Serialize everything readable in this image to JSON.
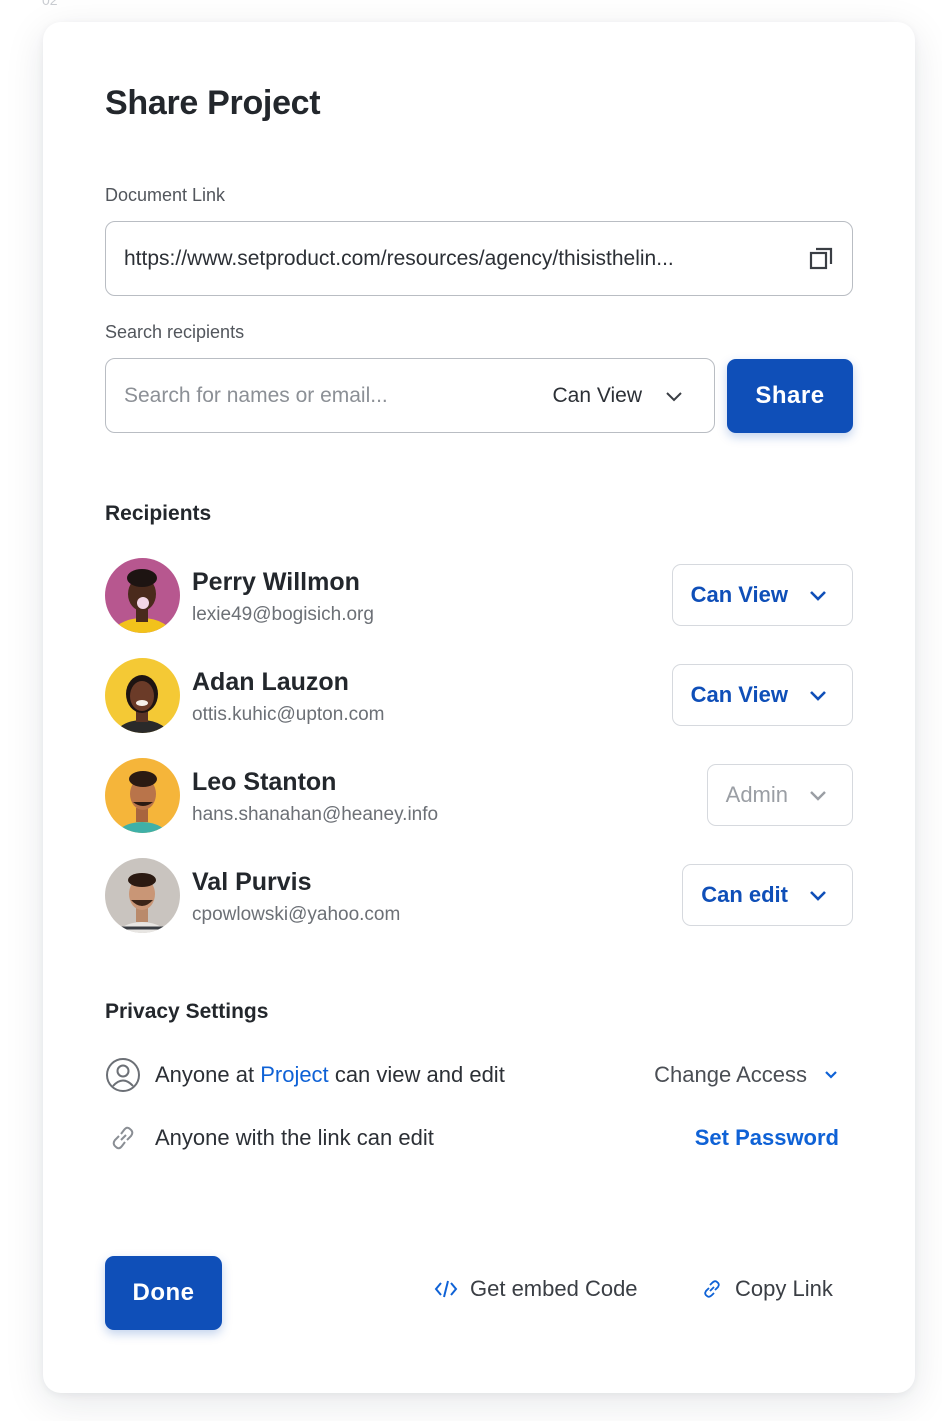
{
  "page_marker": "02",
  "modal": {
    "title": "Share Project",
    "document_link": {
      "label": "Document Link",
      "value": "https://www.setproduct.com/resources/agency/thisisthelin..."
    },
    "search": {
      "label": "Search recipients",
      "placeholder": "Search for names or email...",
      "permission": "Can View",
      "share_label": "Share"
    },
    "recipients": {
      "title": "Recipients",
      "items": [
        {
          "name": "Perry Willmon",
          "email": "lexie49@bogisich.org",
          "role": "Can View",
          "role_enabled": true,
          "avatar_bg": "#b7578f",
          "shirt": "#f2c21b"
        },
        {
          "name": "Adan Lauzon",
          "email": "ottis.kuhic@upton.com",
          "role": "Can View",
          "role_enabled": true,
          "avatar_bg": "#f4c935",
          "shirt": "#2a2a2a"
        },
        {
          "name": "Leo Stanton",
          "email": "hans.shanahan@heaney.info",
          "role": "Admin",
          "role_enabled": false,
          "avatar_bg": "#f5b53a",
          "shirt": "#3fb0a8"
        },
        {
          "name": "Val Purvis",
          "email": "cpowlowski@yahoo.com",
          "role": "Can edit",
          "role_enabled": true,
          "avatar_bg": "#c9c4bf",
          "shirt": "#e8e6e3"
        }
      ]
    },
    "privacy": {
      "title": "Privacy Settings",
      "access_prefix": "Anyone at",
      "access_project": "Project",
      "access_suffix": "can view and edit",
      "change_access_label": "Change Access",
      "link_text": "Anyone with the link can edit",
      "set_password_label": "Set Password"
    },
    "footer": {
      "done_label": "Done",
      "embed_label": "Get embed Code",
      "copy_link_label": "Copy Link"
    }
  },
  "colors": {
    "primary": "#0f4fb8",
    "accent_link": "#0f62d6",
    "border": "#b9bdc3"
  }
}
